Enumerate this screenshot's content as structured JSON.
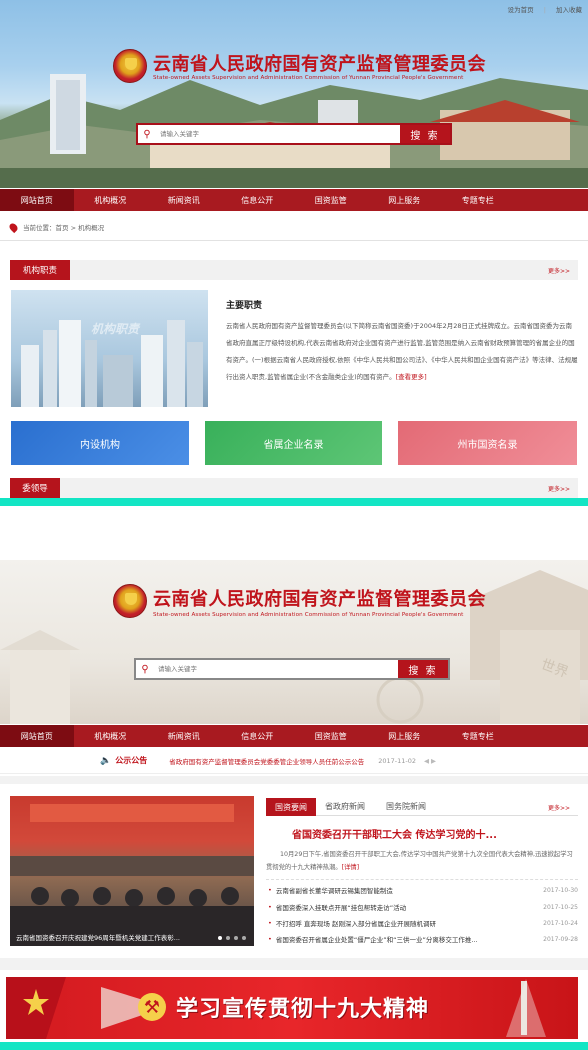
{
  "top_links": [
    "设为首页",
    "加入收藏"
  ],
  "site": {
    "title": "云南省人民政府国有资产监督管理委员会",
    "subtitle": "State-owned Assets Supervision and Administration Commission of Yunnan Provincial People's Government",
    "emblem_icon": "national-emblem-icon"
  },
  "search": {
    "placeholder": "请输入关键字",
    "button": "搜 索",
    "icon": "search-icon"
  },
  "nav": [
    "网站首页",
    "机构概况",
    "新闻资讯",
    "信息公开",
    "国资监管",
    "网上服务",
    "专题专栏"
  ],
  "breadcrumb": {
    "label": "当前位置：",
    "path": "首页 > 机构概况"
  },
  "duties": {
    "tab": "机构职责",
    "more": "更多>>",
    "image_caption": "机构职责",
    "heading": "主要职责",
    "text": "云南省人民政府国有资产监督管理委员会(以下简称云南省国资委)于2004年2月28日正式挂牌成立。云南省国资委为云南省政府直属正厅级特设机构,代表云南省政府对企业国有资产进行监管,监管范围是纳入云南省财政预算管理的省属企业的国有资产。(一)根据云南省人民政府授权,依照《中华人民共和国公司法》、《中华人民共和国企业国有资产法》等法律、法规履行出资人职责,监管省属企业(不含金融类企业)的国有资产。",
    "read_more": "[查看更多]"
  },
  "tiles": [
    "内设机构",
    "省属企业名录",
    "州市国资名录"
  ],
  "leaders": {
    "tab": "委领导",
    "more": "更多>>"
  },
  "notice": {
    "label": "公示公告",
    "text": "省政府国有资产监督管理委员会党委委管企业领导人员任前公示公告",
    "date": "2017-11-02"
  },
  "slider": {
    "caption": "云南省国资委召开庆祝建党96周年暨机关党建工作表彰..."
  },
  "news": {
    "tabs": [
      "国资要闻",
      "省政府新闻",
      "国务院新闻"
    ],
    "more": "更多>>",
    "headline": "省国资委召开干部职工大会 传达学习党的十...",
    "summary": "10月29日下午,省国资委召开干部职工大会,传达学习中国共产党第十九次全国代表大会精神,迅速掀起学习贯彻党的十九大精神热潮。",
    "detail": "[详情]",
    "items": [
      {
        "title": "云南省副省长董华调研云锡集团智能制造",
        "date": "2017-10-30"
      },
      {
        "title": "省国资委深入挂联点开展“挂包帮转走访”活动",
        "date": "2017-10-25"
      },
      {
        "title": "不打招呼 直奔现场 赵刚深入部分省属企业开展随机调研",
        "date": "2017-10-24"
      },
      {
        "title": "省国资委召开省属企业处置“僵尸企业”和“三供一业”分离移交工作推...",
        "date": "2017-09-28"
      }
    ]
  },
  "banner": {
    "text": "学习宣传贯彻十九大精神"
  },
  "colors": {
    "brand_red": "#b5141c",
    "nav_red": "#a81a20",
    "accent_teal": "#13e5c4"
  }
}
